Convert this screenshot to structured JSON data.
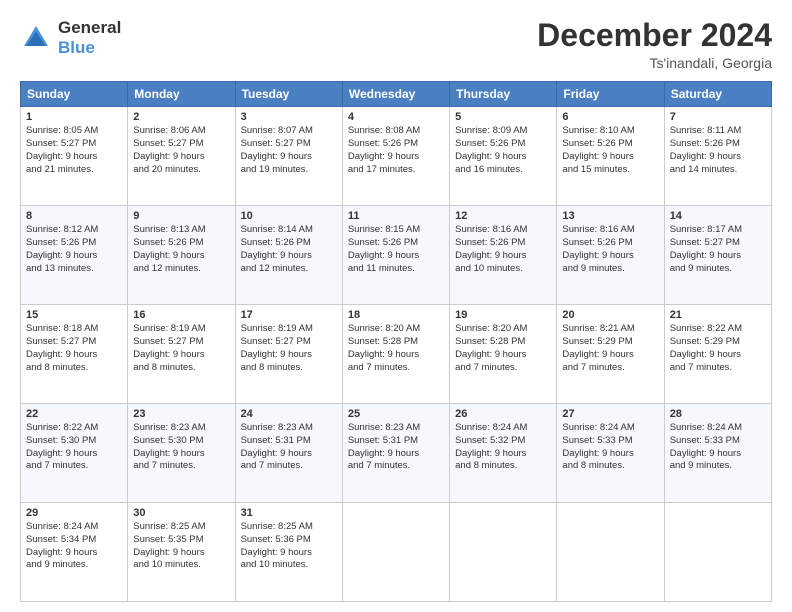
{
  "header": {
    "logo_general": "General",
    "logo_blue": "Blue",
    "month": "December 2024",
    "location": "Ts'inandali, Georgia"
  },
  "days_of_week": [
    "Sunday",
    "Monday",
    "Tuesday",
    "Wednesday",
    "Thursday",
    "Friday",
    "Saturday"
  ],
  "weeks": [
    [
      {
        "day": 1,
        "lines": [
          "Sunrise: 8:05 AM",
          "Sunset: 5:27 PM",
          "Daylight: 9 hours",
          "and 21 minutes."
        ]
      },
      {
        "day": 2,
        "lines": [
          "Sunrise: 8:06 AM",
          "Sunset: 5:27 PM",
          "Daylight: 9 hours",
          "and 20 minutes."
        ]
      },
      {
        "day": 3,
        "lines": [
          "Sunrise: 8:07 AM",
          "Sunset: 5:27 PM",
          "Daylight: 9 hours",
          "and 19 minutes."
        ]
      },
      {
        "day": 4,
        "lines": [
          "Sunrise: 8:08 AM",
          "Sunset: 5:26 PM",
          "Daylight: 9 hours",
          "and 17 minutes."
        ]
      },
      {
        "day": 5,
        "lines": [
          "Sunrise: 8:09 AM",
          "Sunset: 5:26 PM",
          "Daylight: 9 hours",
          "and 16 minutes."
        ]
      },
      {
        "day": 6,
        "lines": [
          "Sunrise: 8:10 AM",
          "Sunset: 5:26 PM",
          "Daylight: 9 hours",
          "and 15 minutes."
        ]
      },
      {
        "day": 7,
        "lines": [
          "Sunrise: 8:11 AM",
          "Sunset: 5:26 PM",
          "Daylight: 9 hours",
          "and 14 minutes."
        ]
      }
    ],
    [
      {
        "day": 8,
        "lines": [
          "Sunrise: 8:12 AM",
          "Sunset: 5:26 PM",
          "Daylight: 9 hours",
          "and 13 minutes."
        ]
      },
      {
        "day": 9,
        "lines": [
          "Sunrise: 8:13 AM",
          "Sunset: 5:26 PM",
          "Daylight: 9 hours",
          "and 12 minutes."
        ]
      },
      {
        "day": 10,
        "lines": [
          "Sunrise: 8:14 AM",
          "Sunset: 5:26 PM",
          "Daylight: 9 hours",
          "and 12 minutes."
        ]
      },
      {
        "day": 11,
        "lines": [
          "Sunrise: 8:15 AM",
          "Sunset: 5:26 PM",
          "Daylight: 9 hours",
          "and 11 minutes."
        ]
      },
      {
        "day": 12,
        "lines": [
          "Sunrise: 8:16 AM",
          "Sunset: 5:26 PM",
          "Daylight: 9 hours",
          "and 10 minutes."
        ]
      },
      {
        "day": 13,
        "lines": [
          "Sunrise: 8:16 AM",
          "Sunset: 5:26 PM",
          "Daylight: 9 hours",
          "and 9 minutes."
        ]
      },
      {
        "day": 14,
        "lines": [
          "Sunrise: 8:17 AM",
          "Sunset: 5:27 PM",
          "Daylight: 9 hours",
          "and 9 minutes."
        ]
      }
    ],
    [
      {
        "day": 15,
        "lines": [
          "Sunrise: 8:18 AM",
          "Sunset: 5:27 PM",
          "Daylight: 9 hours",
          "and 8 minutes."
        ]
      },
      {
        "day": 16,
        "lines": [
          "Sunrise: 8:19 AM",
          "Sunset: 5:27 PM",
          "Daylight: 9 hours",
          "and 8 minutes."
        ]
      },
      {
        "day": 17,
        "lines": [
          "Sunrise: 8:19 AM",
          "Sunset: 5:27 PM",
          "Daylight: 9 hours",
          "and 8 minutes."
        ]
      },
      {
        "day": 18,
        "lines": [
          "Sunrise: 8:20 AM",
          "Sunset: 5:28 PM",
          "Daylight: 9 hours",
          "and 7 minutes."
        ]
      },
      {
        "day": 19,
        "lines": [
          "Sunrise: 8:20 AM",
          "Sunset: 5:28 PM",
          "Daylight: 9 hours",
          "and 7 minutes."
        ]
      },
      {
        "day": 20,
        "lines": [
          "Sunrise: 8:21 AM",
          "Sunset: 5:29 PM",
          "Daylight: 9 hours",
          "and 7 minutes."
        ]
      },
      {
        "day": 21,
        "lines": [
          "Sunrise: 8:22 AM",
          "Sunset: 5:29 PM",
          "Daylight: 9 hours",
          "and 7 minutes."
        ]
      }
    ],
    [
      {
        "day": 22,
        "lines": [
          "Sunrise: 8:22 AM",
          "Sunset: 5:30 PM",
          "Daylight: 9 hours",
          "and 7 minutes."
        ]
      },
      {
        "day": 23,
        "lines": [
          "Sunrise: 8:23 AM",
          "Sunset: 5:30 PM",
          "Daylight: 9 hours",
          "and 7 minutes."
        ]
      },
      {
        "day": 24,
        "lines": [
          "Sunrise: 8:23 AM",
          "Sunset: 5:31 PM",
          "Daylight: 9 hours",
          "and 7 minutes."
        ]
      },
      {
        "day": 25,
        "lines": [
          "Sunrise: 8:23 AM",
          "Sunset: 5:31 PM",
          "Daylight: 9 hours",
          "and 7 minutes."
        ]
      },
      {
        "day": 26,
        "lines": [
          "Sunrise: 8:24 AM",
          "Sunset: 5:32 PM",
          "Daylight: 9 hours",
          "and 8 minutes."
        ]
      },
      {
        "day": 27,
        "lines": [
          "Sunrise: 8:24 AM",
          "Sunset: 5:33 PM",
          "Daylight: 9 hours",
          "and 8 minutes."
        ]
      },
      {
        "day": 28,
        "lines": [
          "Sunrise: 8:24 AM",
          "Sunset: 5:33 PM",
          "Daylight: 9 hours",
          "and 9 minutes."
        ]
      }
    ],
    [
      {
        "day": 29,
        "lines": [
          "Sunrise: 8:24 AM",
          "Sunset: 5:34 PM",
          "Daylight: 9 hours",
          "and 9 minutes."
        ]
      },
      {
        "day": 30,
        "lines": [
          "Sunrise: 8:25 AM",
          "Sunset: 5:35 PM",
          "Daylight: 9 hours",
          "and 10 minutes."
        ]
      },
      {
        "day": 31,
        "lines": [
          "Sunrise: 8:25 AM",
          "Sunset: 5:36 PM",
          "Daylight: 9 hours",
          "and 10 minutes."
        ]
      },
      null,
      null,
      null,
      null
    ]
  ]
}
